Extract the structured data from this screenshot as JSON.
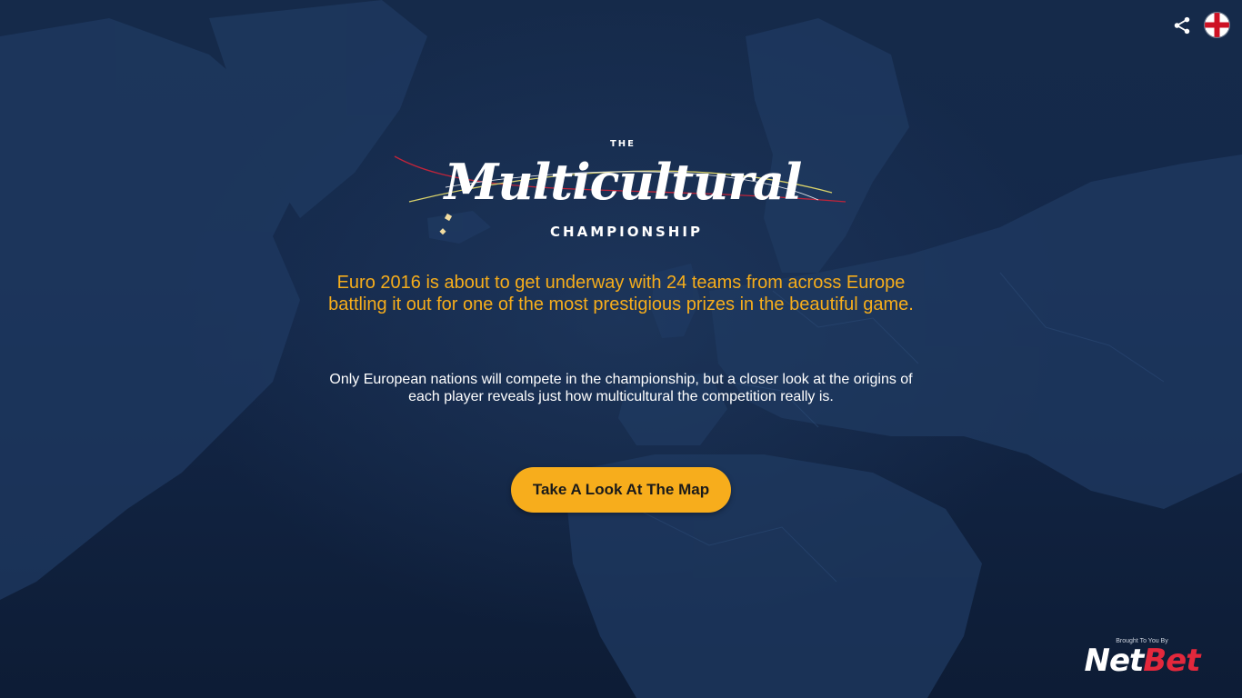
{
  "header": {
    "share_icon": "share-icon",
    "language_flag_icon": "england-flag-icon"
  },
  "logo": {
    "the": "THE",
    "script": "Multicultural",
    "championship": "CHAMPIONSHIP"
  },
  "intro": {
    "lead": "Euro 2016 is about to get underway with 24 teams from across Europe battling it out for one of the most prestigious prizes in the beautiful game.",
    "sub": "Only European nations will compete in the championship, but a closer look at the origins of each player reveals just how multicultural the competition really is."
  },
  "cta": {
    "label": "Take A Look At The Map"
  },
  "brand": {
    "brought_by": "Brought To You By",
    "net": "Net",
    "bet": "Bet"
  },
  "colors": {
    "accent": "#f7ad1c",
    "background": "#14284a",
    "brand_red": "#e3283c",
    "flag_red": "#ce1124"
  }
}
